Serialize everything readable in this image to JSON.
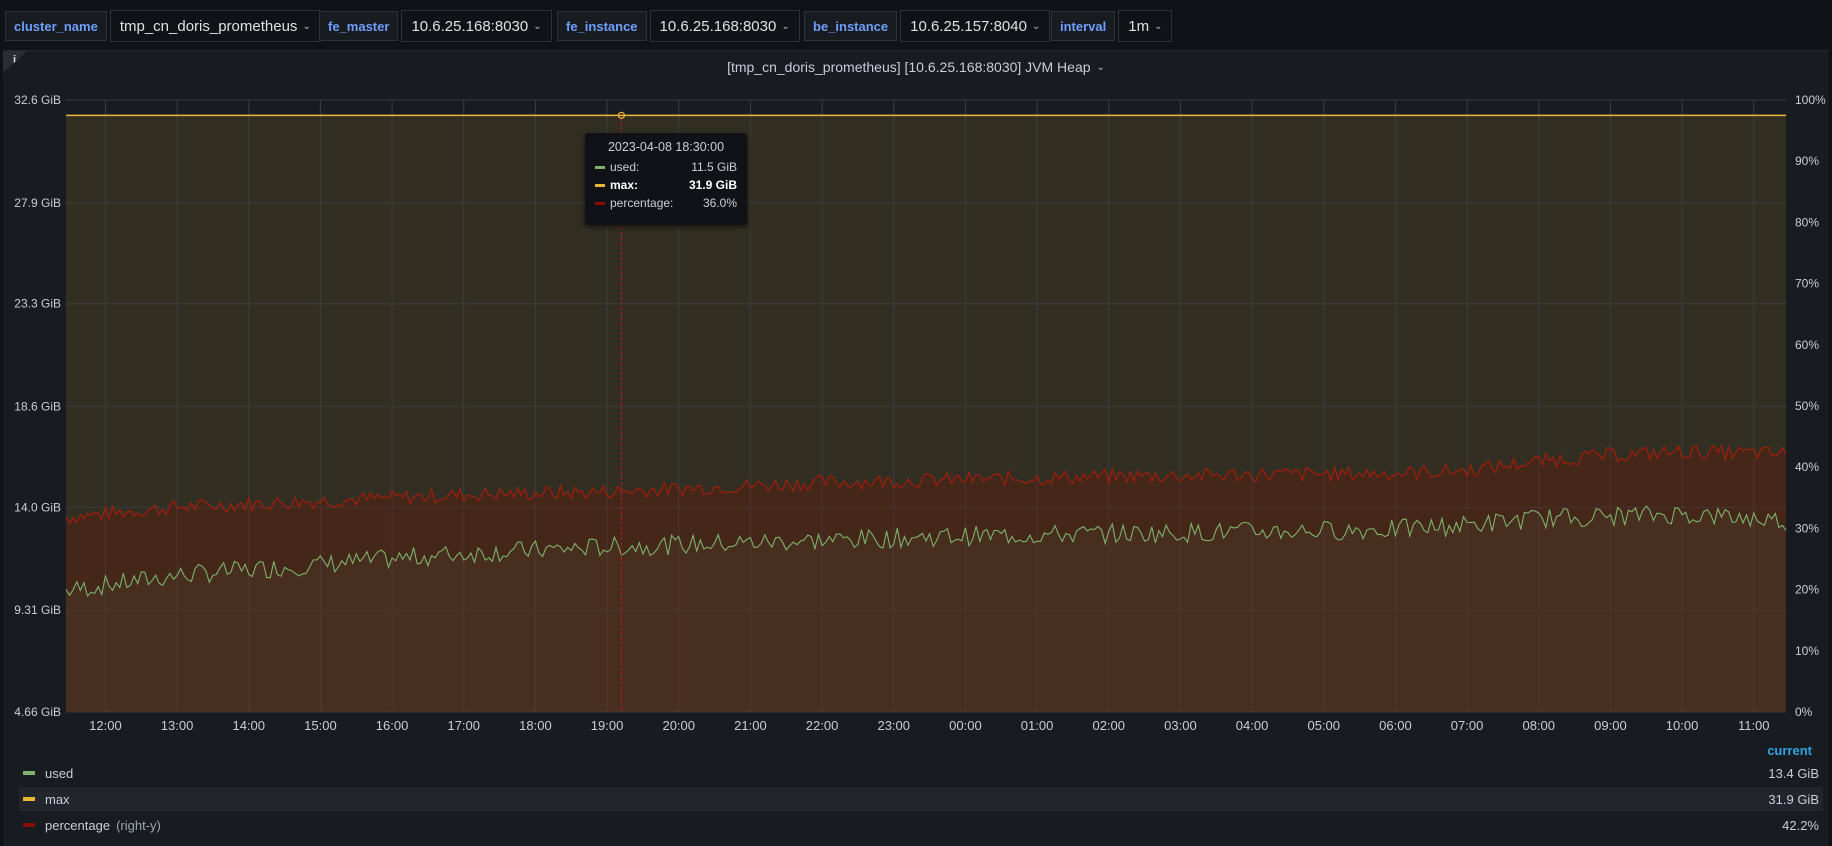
{
  "variables": [
    {
      "label": "cluster_name",
      "value": "tmp_cn_doris_prometheus"
    },
    {
      "label": "fe_master",
      "value": "10.6.25.168:8030"
    },
    {
      "label": "fe_instance",
      "value": "10.6.25.168:8030"
    },
    {
      "label": "be_instance",
      "value": "10.6.25.157:8040"
    },
    {
      "label": "interval",
      "value": "1m"
    }
  ],
  "panel": {
    "info_glyph": "i",
    "title": "[tmp_cn_doris_prometheus] [10.6.25.168:8030] JVM Heap"
  },
  "tooltip": {
    "time": "2023-04-08 18:30:00",
    "rows": [
      {
        "name": "used:",
        "value": "11.5 GiB"
      },
      {
        "name": "max:",
        "value": "31.9 GiB"
      },
      {
        "name": "percentage:",
        "value": "36.0%"
      }
    ]
  },
  "legend": {
    "header": "current",
    "items": [
      {
        "name": "used",
        "suffix": "",
        "value": "13.4 GiB"
      },
      {
        "name": "max",
        "suffix": "",
        "value": "31.9 GiB"
      },
      {
        "name": "percentage",
        "suffix": "(right-y)",
        "value": "42.2%"
      }
    ]
  },
  "colors": {
    "used": "#7eb26d",
    "max": "#eab839",
    "percentage": "#890f02",
    "crosshair": "#c4162a",
    "grid": "#3a3d42"
  },
  "chart_data": {
    "type": "line",
    "title": "[tmp_cn_doris_prometheus] [10.6.25.168:8030] JVM Heap",
    "x_ticks": [
      "12:00",
      "13:00",
      "14:00",
      "15:00",
      "16:00",
      "17:00",
      "18:00",
      "19:00",
      "20:00",
      "21:00",
      "22:00",
      "23:00",
      "00:00",
      "01:00",
      "02:00",
      "03:00",
      "04:00",
      "05:00",
      "06:00",
      "07:00",
      "08:00",
      "09:00",
      "10:00",
      "11:00"
    ],
    "x_range_hours": [
      11.45,
      35.45
    ],
    "hover_hour": 19.2,
    "y_left_ticks": [
      "4.66 GiB",
      "9.31 GiB",
      "14.0 GiB",
      "18.6 GiB",
      "23.3 GiB",
      "27.9 GiB",
      "32.6 GiB"
    ],
    "y_left_range": [
      4.66,
      32.6
    ],
    "y_right_ticks": [
      "0%",
      "10%",
      "20%",
      "30%",
      "40%",
      "50%",
      "60%",
      "70%",
      "80%",
      "90%",
      "100%"
    ],
    "y_right_range": [
      0,
      100
    ],
    "series": [
      {
        "name": "used",
        "axis": "left",
        "unit": "GiB",
        "x": [
          11.45,
          13,
          15,
          17,
          19,
          20,
          22,
          24,
          26,
          28,
          30,
          31,
          32,
          33,
          34,
          35.45
        ],
        "values": [
          10.2,
          10.9,
          11.4,
          11.9,
          12.2,
          12.3,
          12.5,
          12.7,
          12.8,
          12.9,
          13.0,
          13.2,
          13.5,
          13.6,
          13.7,
          13.4
        ]
      },
      {
        "name": "max",
        "axis": "left",
        "unit": "GiB",
        "x": [
          11.45,
          35.45
        ],
        "values": [
          31.9,
          31.9
        ]
      },
      {
        "name": "percentage",
        "axis": "right",
        "unit": "%",
        "x": [
          11.45,
          13,
          15,
          17,
          19,
          20,
          22,
          24,
          26,
          28,
          30,
          31,
          32,
          33,
          34,
          35.45
        ],
        "values": [
          31.8,
          33.5,
          34.5,
          35.5,
          36.0,
          36.5,
          37.5,
          38.0,
          38.5,
          38.8,
          39.0,
          39.5,
          41.0,
          42.0,
          42.5,
          42.2
        ]
      }
    ],
    "grid": true,
    "legend_position": "bottom"
  }
}
